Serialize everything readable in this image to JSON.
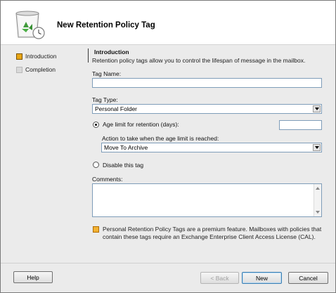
{
  "header": {
    "title": "New Retention Policy Tag",
    "icon": "recycle-bin-clock-icon"
  },
  "sidebar": {
    "items": [
      {
        "label": "Introduction",
        "state": "active"
      },
      {
        "label": "Completion",
        "state": "idle"
      }
    ]
  },
  "main": {
    "section_title": "Introduction",
    "description": "Retention policy tags allow you to control the lifespan of message in the mailbox.",
    "tag_name": {
      "label": "Tag Name:",
      "value": ""
    },
    "tag_type": {
      "label": "Tag Type:",
      "value": "Personal Folder"
    },
    "age_limit": {
      "label": "Age limit for retention (days):",
      "value": "",
      "checked": true
    },
    "action": {
      "label": "Action to take when the age limit is reached:",
      "value": "Move To Archive"
    },
    "disable": {
      "label": "Disable this tag",
      "checked": false
    },
    "comments": {
      "label": "Comments:",
      "value": ""
    },
    "note": {
      "line1": "Personal Retention Policy Tags are a premium feature. Mailboxes with policies that",
      "line2": "contain these tags require an Exchange Enterprise Client Access License (CAL)."
    }
  },
  "footer": {
    "help": "Help",
    "back": "< Back",
    "next": "New",
    "cancel": "Cancel"
  },
  "colors": {
    "accent_active": "#e8a614",
    "input_border": "#7f9db9",
    "window_bg": "#ebebeb"
  }
}
